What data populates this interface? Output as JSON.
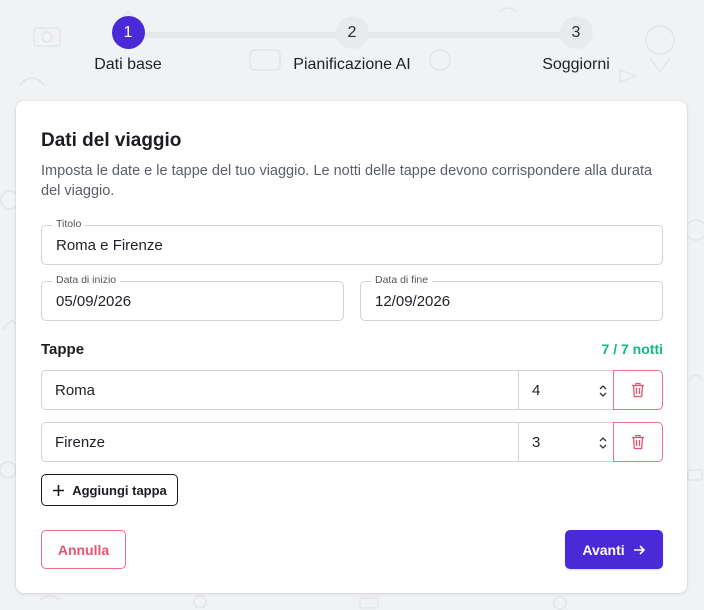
{
  "stepper": {
    "steps": [
      {
        "number": "1",
        "label": "Dati base"
      },
      {
        "number": "2",
        "label": "Pianificazione AI"
      },
      {
        "number": "3",
        "label": "Soggiorni"
      }
    ],
    "active_step": 1
  },
  "card": {
    "title": "Dati del viaggio",
    "description": "Imposta le date e le tappe del tuo viaggio. Le notti delle tappe devono corrispondere alla durata del viaggio."
  },
  "form": {
    "title": {
      "label": "Titolo",
      "value": "Roma e Firenze"
    },
    "start_date": {
      "label": "Data di inizio",
      "value": "05/09/2026"
    },
    "end_date": {
      "label": "Data di fine",
      "value": "12/09/2026"
    }
  },
  "stages": {
    "heading": "Tappe",
    "nights_summary": "7 / 7 notti",
    "items": [
      {
        "name": "Roma",
        "nights": "4"
      },
      {
        "name": "Firenze",
        "nights": "3"
      }
    ],
    "add_label": "Aggiungi tappa"
  },
  "actions": {
    "cancel_label": "Annulla",
    "next_label": "Avanti"
  },
  "colors": {
    "accent": "#4a2ad6",
    "success": "#12b886",
    "danger": "#e5536f",
    "background": "#f1f2f4"
  },
  "icons": {
    "delete": "trash-icon",
    "add": "plus-icon",
    "next": "arrow-right-icon",
    "spinner": "up-down-chevron-icon"
  }
}
